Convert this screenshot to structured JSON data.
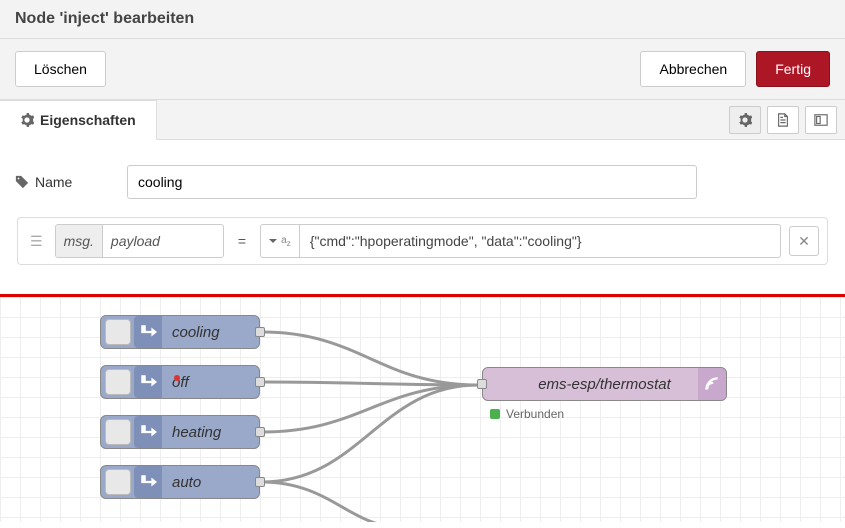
{
  "header": {
    "title": "Node 'inject' bearbeiten",
    "delete_label": "Löschen",
    "cancel_label": "Abbrechen",
    "done_label": "Fertig"
  },
  "tabs": {
    "properties_label": "Eigenschaften"
  },
  "form": {
    "name_label": "Name",
    "name_value": "cooling"
  },
  "property": {
    "msg_prefix": "msg.",
    "msg_field": "payload",
    "equals": "=",
    "value_text": "{\"cmd\":\"hpoperatingmode\", \"data\":\"cooling\"}"
  },
  "flow": {
    "nodes": [
      {
        "label": "cooling"
      },
      {
        "label": "off"
      },
      {
        "label": "heating"
      },
      {
        "label": "auto"
      }
    ],
    "mqtt_label": "ems-esp/thermostat",
    "status_text": "Verbunden"
  }
}
